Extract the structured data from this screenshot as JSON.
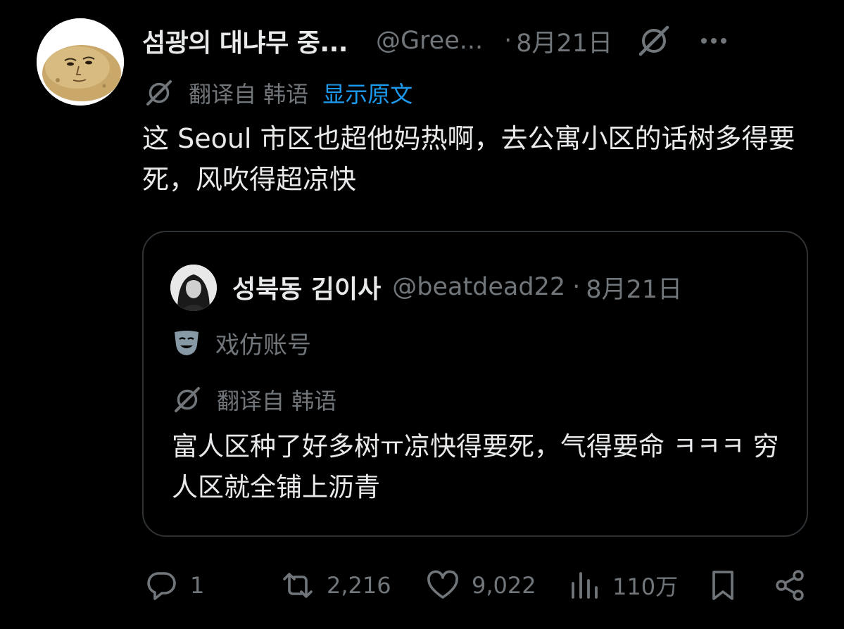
{
  "tweet": {
    "author": {
      "display_name": "섬광의 대냐무 중...",
      "handle": "@Gree...",
      "avatar_icon": "potato-face-avatar"
    },
    "separator": "·",
    "date": "8月21日",
    "grok_icon": "grok-icon",
    "more_icon": "more-options-icon",
    "translated_from": "翻译自 韩语",
    "show_original": "显示原文",
    "text": "这 Seoul 市区也超他妈热啊，去公寓小区的话树多得要死，风吹得超凉快"
  },
  "quote": {
    "author": {
      "display_name": "성북동 김이사",
      "handle": "@beatdead22",
      "avatar_icon": "portrait-avatar"
    },
    "separator": "·",
    "date": "8月21日",
    "account_label": "戏仿账号",
    "account_label_icon": "theater-mask-icon",
    "translated_from": "翻译自 韩语",
    "text": "富人区种了好多树ㅠ凉快得要死，气得要命 ㅋㅋㅋ 穷人区就全铺上沥青"
  },
  "actions": {
    "reply_count": "1",
    "retweet_count": "2,216",
    "like_count": "9,022",
    "views_count": "110万"
  },
  "colors": {
    "background": "#000000",
    "text_primary": "#e7e9ea",
    "text_secondary": "#71767b",
    "link": "#1d9bf0",
    "border": "#2f3336"
  }
}
